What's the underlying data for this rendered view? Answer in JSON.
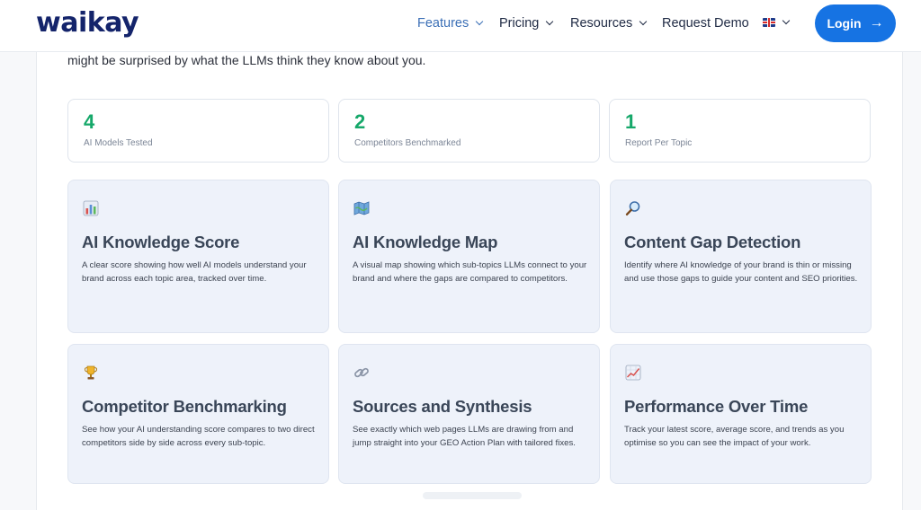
{
  "nav": {
    "logo": "waikay",
    "items": [
      {
        "label": "Features"
      },
      {
        "label": "Pricing"
      },
      {
        "label": "Resources"
      },
      {
        "label": "Request Demo"
      }
    ],
    "login_label": "Login",
    "accent_color": "#1673e3"
  },
  "intro": {
    "text": "might be surprised by what the LLMs think they know about you."
  },
  "stats": [
    {
      "value": "4",
      "label": "AI Models Tested"
    },
    {
      "value": "2",
      "label": "Competitors Benchmarked"
    },
    {
      "value": "1",
      "label": "Report Per Topic"
    }
  ],
  "features": [
    {
      "icon": "bar-chart-icon",
      "title": "AI Knowledge Score",
      "description": "A clear score showing how well AI models understand your brand across each topic area, tracked over time."
    },
    {
      "icon": "map-icon",
      "title": "AI Knowledge Map",
      "description": "A visual map showing which sub-topics LLMs connect to your brand and where the gaps are compared to competitors."
    },
    {
      "icon": "magnifier-icon",
      "title": "Content Gap Detection",
      "description": "Identify where AI knowledge of your brand is thin or missing and use those gaps to guide your content and SEO priorities."
    },
    {
      "icon": "trophy-icon",
      "title": "Competitor Benchmarking",
      "description": "See how your AI understanding score compares to two direct competitors side by side across every sub-topic."
    },
    {
      "icon": "link-icon",
      "title": "Sources and Synthesis",
      "description": "See exactly which web pages LLMs are drawing from and jump straight into your GEO Action Plan with tailored fixes."
    },
    {
      "icon": "trend-chart-icon",
      "title": "Performance Over Time",
      "description": "Track your latest score, average score, and trends as you optimise so you can see the impact of your work."
    }
  ]
}
